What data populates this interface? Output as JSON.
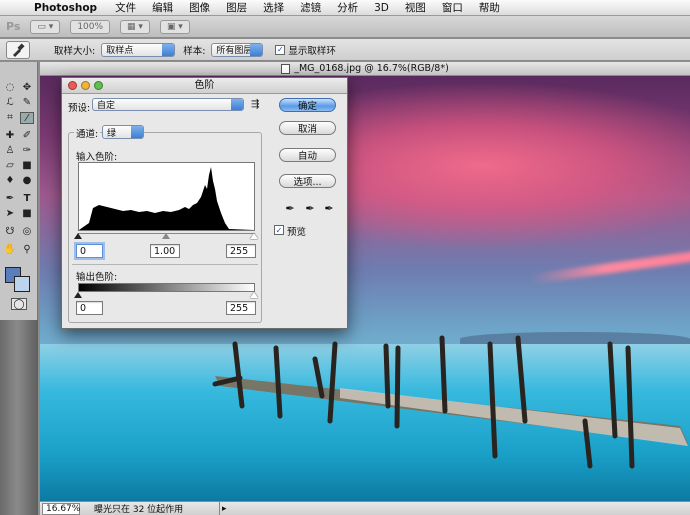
{
  "menubar": {
    "app": "Photoshop",
    "items": [
      "文件",
      "编辑",
      "图像",
      "图层",
      "选择",
      "滤镜",
      "分析",
      "3D",
      "视图",
      "窗口",
      "帮助"
    ]
  },
  "appbar": {
    "logo": "Ps",
    "zoom": "100%"
  },
  "options": {
    "sample_size_label": "取样大小:",
    "sample_size_value": "取样点",
    "sample_label": "样本:",
    "sample_value": "所有图层",
    "show_ring_label": "显示取样环"
  },
  "document": {
    "title": "_MG_0168.jpg @ 16.7%(RGB/8*)"
  },
  "status": {
    "zoom": "16.67%",
    "info": "曝光只在 32 位起作用"
  },
  "levels": {
    "title": "色阶",
    "preset_label": "预设:",
    "preset_value": "自定",
    "channel_label": "通道:",
    "channel_value": "绿",
    "input_label": "输入色阶:",
    "input_black": "0",
    "input_gamma": "1.00",
    "input_white": "255",
    "output_label": "输出色阶:",
    "output_black": "0",
    "output_white": "255",
    "ok": "确定",
    "cancel": "取消",
    "auto": "自动",
    "options": "选项...",
    "preview_label": "预览",
    "preview_checked": true
  },
  "colors": {
    "foreground": "#5a7dbc",
    "background": "#bcd3ee",
    "accent": "#3d7fd6"
  }
}
